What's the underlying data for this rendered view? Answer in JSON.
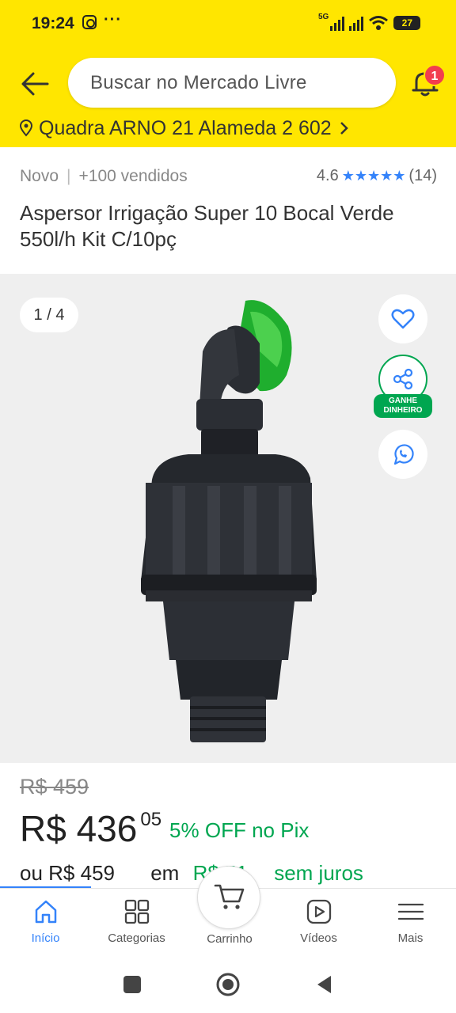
{
  "status_bar": {
    "time": "19:24",
    "dots": "···",
    "network": "5G",
    "battery": "27"
  },
  "header": {
    "search_placeholder": "Buscar no Mercado Livre",
    "notification_count": "1",
    "address": "Quadra ARNO 21 Alameda 2 602"
  },
  "product": {
    "condition": "Novo",
    "separator": "|",
    "sold": "+100 vendidos",
    "rating": "4.6",
    "stars": "★★★★★",
    "reviews": "(14)",
    "title": "Aspersor Irrigação Super 10 Bocal Verde 550l/h Kit C/10pç",
    "image_counter": "1 / 4",
    "earn_badge_line1": "GANHE",
    "earn_badge_line2": "DINHEIRO"
  },
  "price": {
    "original": "R$ 459",
    "current": "R$ 436",
    "cents": "05",
    "discount_pct": "5% OFF",
    "discount_method": "no Pix",
    "installments_prefix": "ou R$ 459",
    "installments_mid": "em",
    "installments_value": "R$ 51",
    "installments_suffix": "sem juros"
  },
  "bottom_nav": {
    "items": [
      {
        "label": "Início",
        "active": true
      },
      {
        "label": "Categorias",
        "active": false
      },
      {
        "label": "Carrinho",
        "active": false
      },
      {
        "label": "Vídeos",
        "active": false
      },
      {
        "label": "Mais",
        "active": false
      }
    ]
  },
  "colors": {
    "brand_yellow": "#ffe600",
    "accent_blue": "#3483fa",
    "green": "#00a650",
    "badge_red": "#f23d4f"
  }
}
